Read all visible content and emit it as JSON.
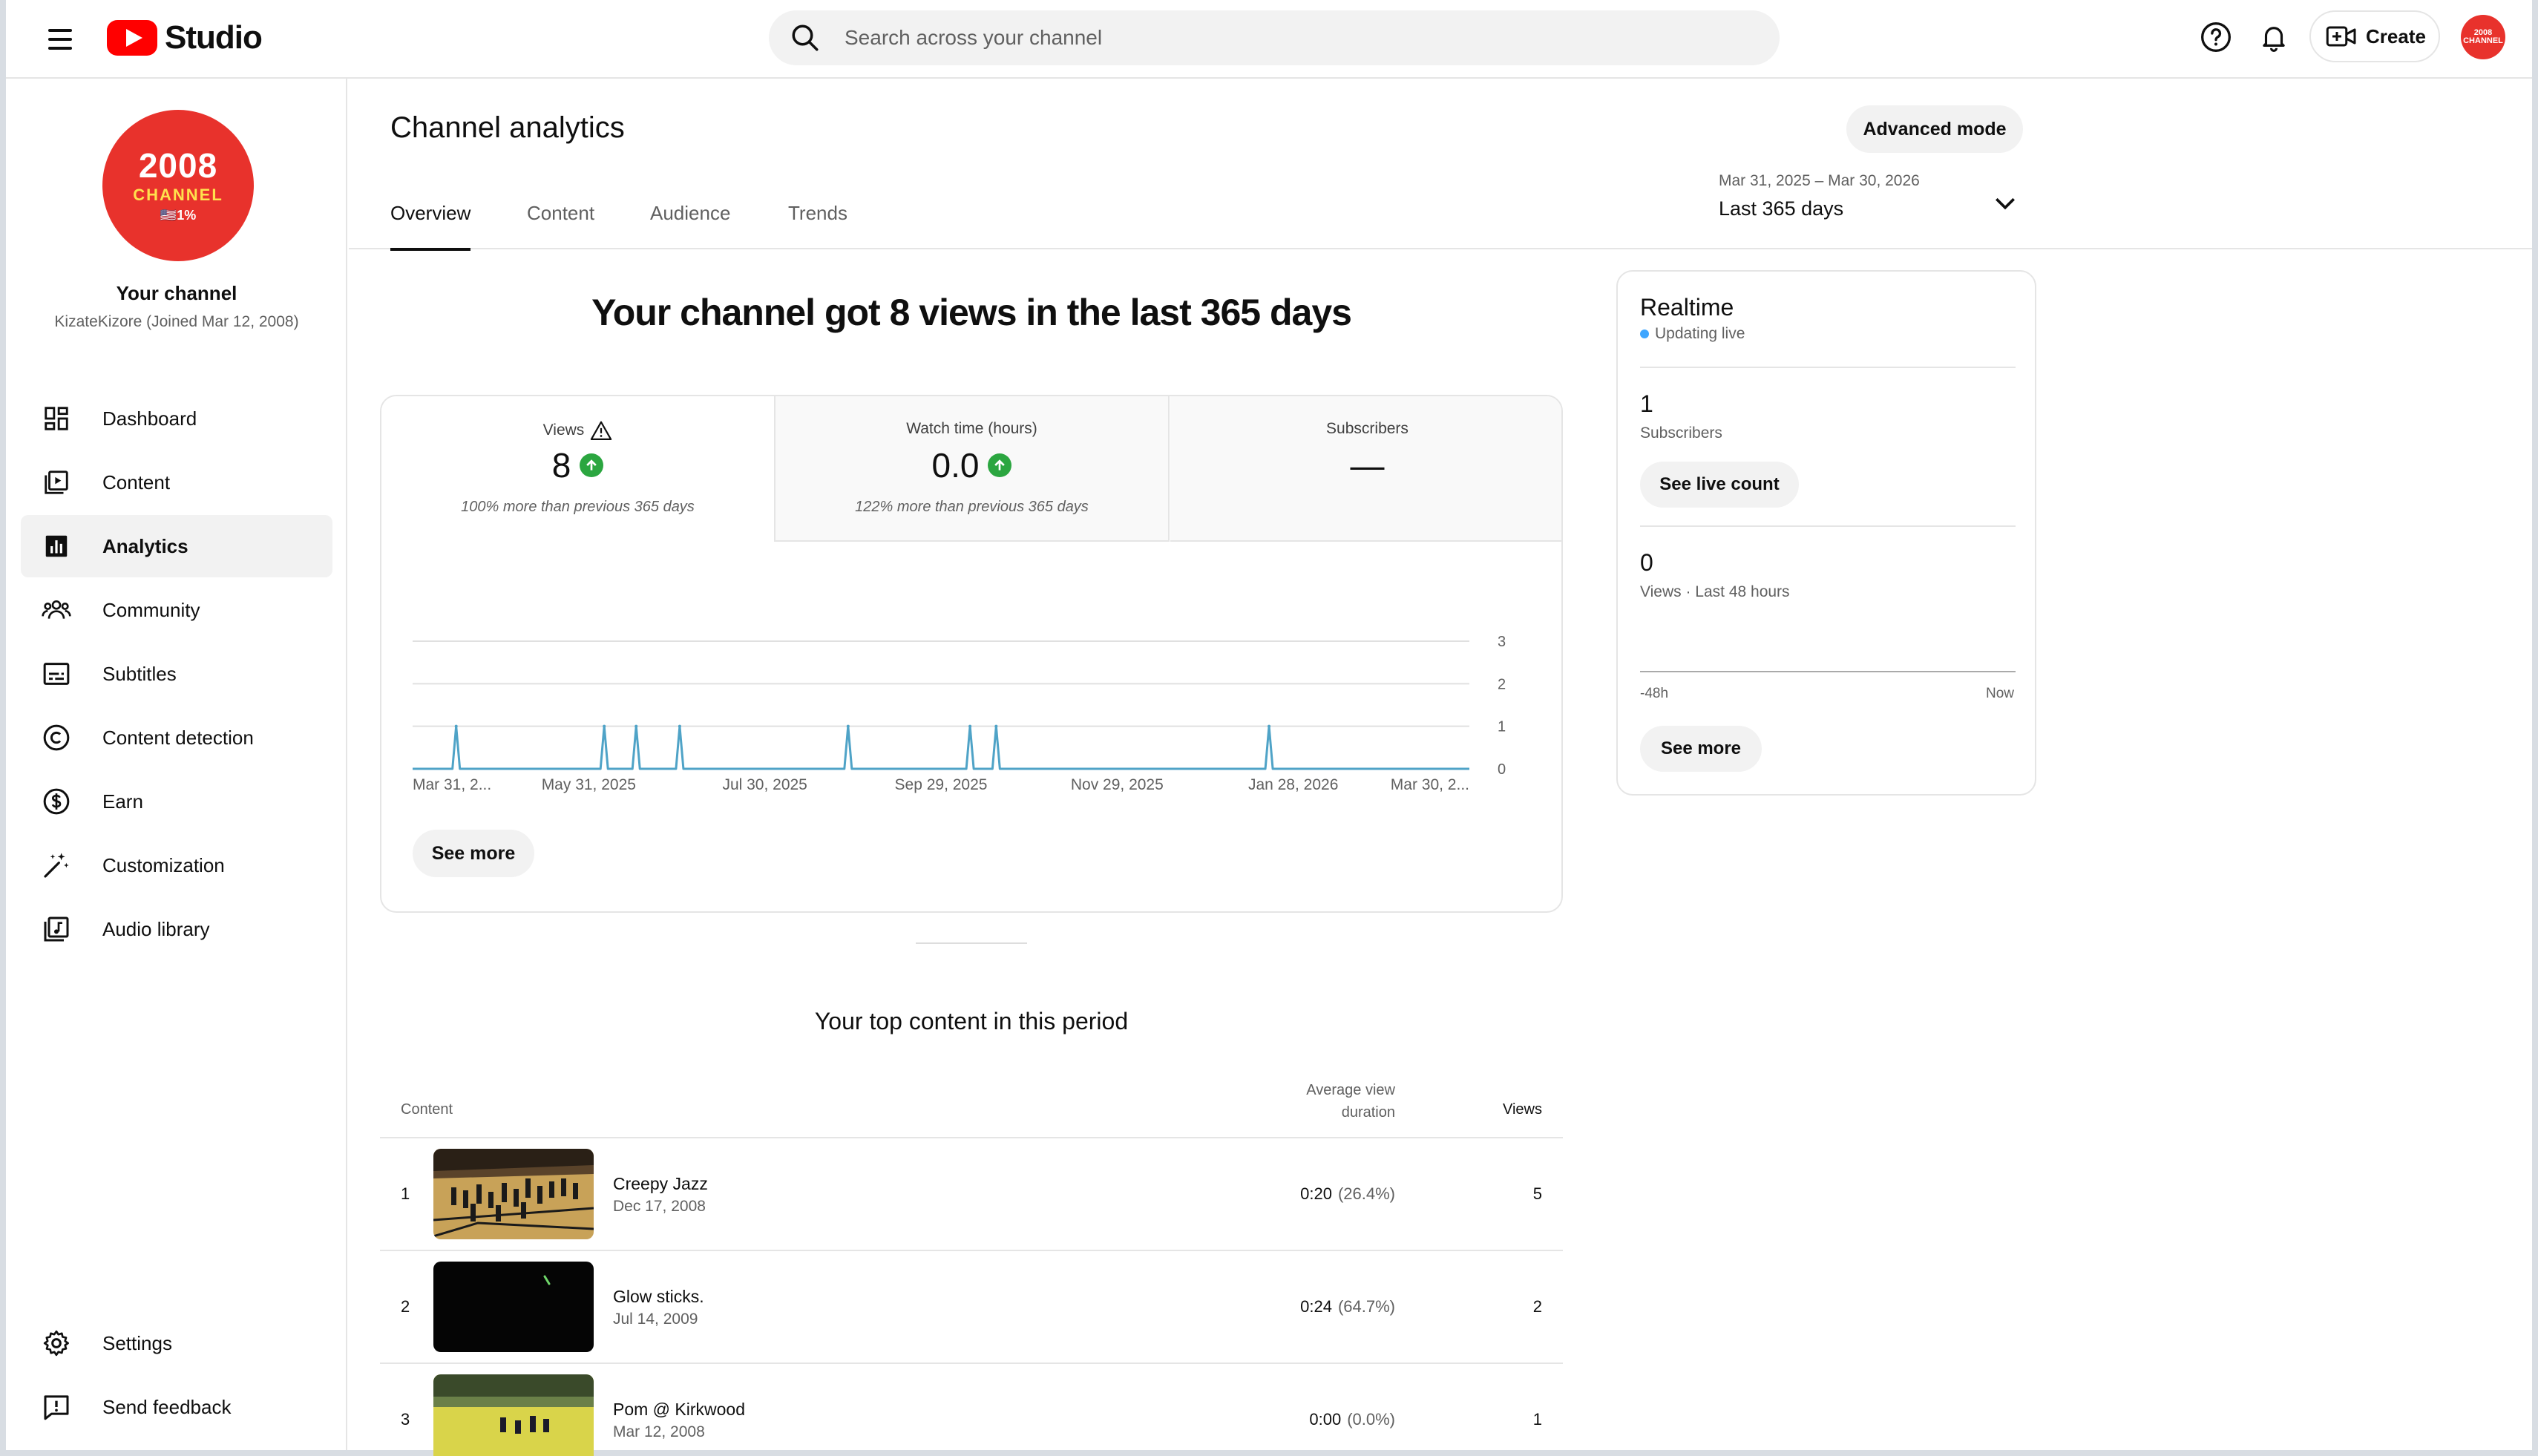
{
  "app": {
    "logo_text": "Studio"
  },
  "search": {
    "placeholder": "Search across your channel"
  },
  "header": {
    "create_label": "Create",
    "avatar_text": "2008 CHANNEL"
  },
  "channel": {
    "avatar_big": "2008",
    "avatar_mid": "CHANNEL",
    "avatar_small": "🇺🇸1%",
    "title": "Your channel",
    "subtitle": "KizateKizore (Joined Mar 12, 2008)"
  },
  "sidebar": {
    "items": [
      {
        "label": "Dashboard",
        "icon": "dashboard-icon"
      },
      {
        "label": "Content",
        "icon": "content-icon"
      },
      {
        "label": "Analytics",
        "icon": "analytics-icon",
        "active": true
      },
      {
        "label": "Community",
        "icon": "community-icon"
      },
      {
        "label": "Subtitles",
        "icon": "subtitles-icon"
      },
      {
        "label": "Content detection",
        "icon": "copyright-icon"
      },
      {
        "label": "Earn",
        "icon": "dollar-icon"
      },
      {
        "label": "Customization",
        "icon": "magic-wand-icon"
      },
      {
        "label": "Audio library",
        "icon": "audio-library-icon"
      }
    ],
    "bottom": [
      {
        "label": "Settings",
        "icon": "gear-icon"
      },
      {
        "label": "Send feedback",
        "icon": "feedback-icon"
      }
    ]
  },
  "page": {
    "title": "Channel analytics",
    "tabs": [
      "Overview",
      "Content",
      "Audience",
      "Trends"
    ],
    "advanced_mode": "Advanced mode",
    "date_range": "Mar 31, 2025 – Mar 30, 2026",
    "date_label": "Last 365 days"
  },
  "overview": {
    "headline": "Your channel got 8 views in the last 365 days",
    "metrics": [
      {
        "label": "Views",
        "value": "8",
        "note": "100% more than previous 365 days",
        "warning": true,
        "trend": "up"
      },
      {
        "label": "Watch time (hours)",
        "value": "0.0",
        "note": "122% more than previous 365 days",
        "trend": "up"
      },
      {
        "label": "Subscribers",
        "value": "—",
        "note": ""
      }
    ],
    "see_more": "See more"
  },
  "chart_data": {
    "type": "line",
    "title": "",
    "xlabel": "",
    "ylabel": "",
    "ylim": [
      0,
      3
    ],
    "yticks": [
      0,
      1,
      2,
      3
    ],
    "xtick_labels": [
      "Mar 31, 2...",
      "May 31, 2025",
      "Jul 30, 2025",
      "Sep 29, 2025",
      "Nov 29, 2025",
      "Jan 28, 2026",
      "Mar 30, 2..."
    ],
    "x_range": [
      "2025-03-31",
      "2026-03-30"
    ],
    "series": [
      {
        "color": "#4fa3c7",
        "points": [
          {
            "x": "2025-04-15",
            "y": 1
          },
          {
            "x": "2025-06-05",
            "y": 1
          },
          {
            "x": "2025-06-16",
            "y": 1
          },
          {
            "x": "2025-07-01",
            "y": 1
          },
          {
            "x": "2025-08-28",
            "y": 1
          },
          {
            "x": "2025-10-09",
            "y": 1
          },
          {
            "x": "2025-10-18",
            "y": 1
          },
          {
            "x": "2026-01-20",
            "y": 1
          }
        ]
      }
    ],
    "grid": true
  },
  "top_content": {
    "title": "Your top content in this period",
    "col_content": "Content",
    "col_avd_line1": "Average view",
    "col_avd_line2": "duration",
    "col_views": "Views",
    "rows": [
      {
        "rank": "1",
        "title": "Creepy Jazz",
        "date": "Dec 17, 2008",
        "avd": "0:20",
        "pct": "(26.4%)",
        "views": "5"
      },
      {
        "rank": "2",
        "title": "Glow sticks.",
        "date": "Jul 14, 2009",
        "avd": "0:24",
        "pct": "(64.7%)",
        "views": "2"
      },
      {
        "rank": "3",
        "title": "Pom @ Kirkwood",
        "date": "Mar 12, 2008",
        "avd": "0:00",
        "pct": "(0.0%)",
        "views": "1"
      }
    ]
  },
  "realtime": {
    "title": "Realtime",
    "live": "Updating live",
    "subs_value": "1",
    "subs_caption": "Subscribers",
    "see_live_count": "See live count",
    "views_value": "0",
    "views_caption": "Views · Last 48 hours",
    "axis_left": "-48h",
    "axis_right": "Now",
    "see_more": "See more"
  }
}
